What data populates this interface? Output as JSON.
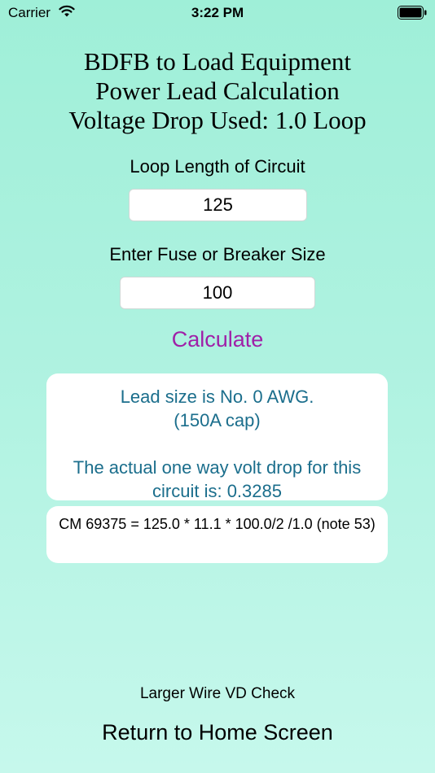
{
  "status_bar": {
    "carrier": "Carrier",
    "time": "3:22 PM",
    "wifi_icon": "wifi-icon",
    "battery_icon": "battery-icon"
  },
  "title": {
    "line1": "BDFB to Load Equipment",
    "line2": "Power Lead Calculation",
    "line3": "Voltage Drop Used: 1.0 Loop"
  },
  "loop_length": {
    "label": "Loop Length of Circuit",
    "value": "125"
  },
  "fuse_size": {
    "label": "Enter Fuse or Breaker Size",
    "value": "100"
  },
  "calculate_label": "Calculate",
  "result": {
    "line1": "Lead size is No. 0 AWG.",
    "line2": "(150A cap)",
    "line3": "The actual one way volt drop for this",
    "line4": "circuit is: 0.3285"
  },
  "formula": "CM 69375 = 125.0 * 11.1 * 100.0/2 /1.0 (note 53)",
  "larger_wire_label": "Larger Wire VD Check",
  "home_label": "Return to Home Screen",
  "colors": {
    "calculate": "#a020a8",
    "result_text": "#1b6e8c",
    "background_top": "#9fefd8",
    "background_bottom": "#c6f8ec"
  }
}
